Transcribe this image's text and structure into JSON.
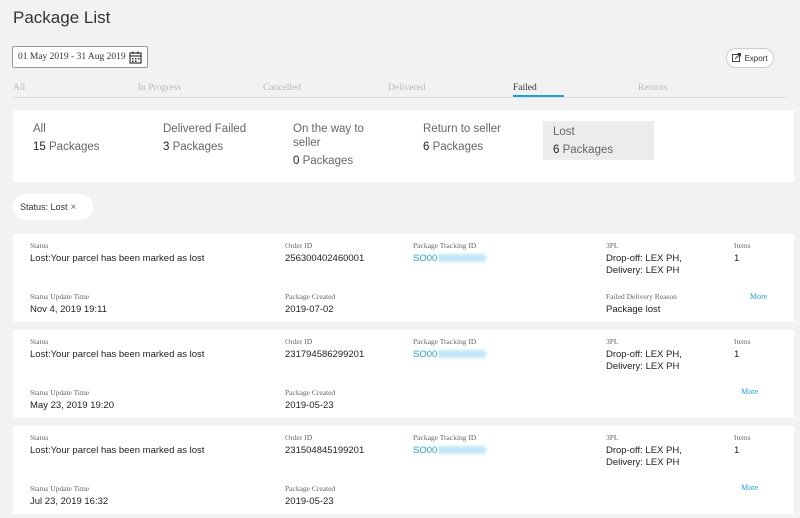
{
  "page": {
    "title": "Package List"
  },
  "date_range": {
    "value": "01 May 2019 - 31 Aug 2019"
  },
  "export": {
    "label": "Export"
  },
  "tabs": [
    {
      "label": "All"
    },
    {
      "label": "In Progress"
    },
    {
      "label": "Cancelled"
    },
    {
      "label": "Delivered"
    },
    {
      "label": "Failed"
    },
    {
      "label": "Returns"
    }
  ],
  "active_tab": "Failed",
  "summary": [
    {
      "label": "All",
      "count": "15",
      "unit": "Packages"
    },
    {
      "label": "Delivered Failed",
      "count": "3",
      "unit": "Packages"
    },
    {
      "label": "On the way to seller",
      "count": "0",
      "unit": "Packages"
    },
    {
      "label": "Return to seller",
      "count": "6",
      "unit": "Packages"
    },
    {
      "label": "Lost",
      "count": "6",
      "unit": "Packages"
    }
  ],
  "filter": {
    "label": "Status: Lost",
    "remove": "×"
  },
  "labels": {
    "status": "Status",
    "order_id": "Order ID",
    "tracking": "Package Tracking ID",
    "tpl": "3PL",
    "items": "Items",
    "status_update": "Status Update Time",
    "created": "Package Created",
    "failed_reason": "Failed Delivery Reason",
    "more": "More"
  },
  "packages": [
    {
      "status": "Lost:Your parcel has been marked as lost",
      "order_id": "256300402460001",
      "tracking_prefix": "SO00",
      "tpl_line1": "Drop-off: LEX PH,",
      "tpl_line2": "Delivery: LEX PH",
      "items": "1",
      "status_update": "Nov 4, 2019 19:11",
      "created": "2019-07-02",
      "failed_reason": "Package lost"
    },
    {
      "status": "Lost:Your parcel has been marked as lost",
      "order_id": "231794586299201",
      "tracking_prefix": "SO00",
      "tpl_line1": "Drop-off: LEX PH,",
      "tpl_line2": "Delivery: LEX PH",
      "items": "1",
      "status_update": "May 23, 2019 19:20",
      "created": "2019-05-23"
    },
    {
      "status": "Lost:Your parcel has been marked as lost",
      "order_id": "231504845199201",
      "tracking_prefix": "SO00",
      "tpl_line1": "Drop-off: LEX PH,",
      "tpl_line2": "Delivery: LEX PH",
      "items": "1",
      "status_update": "Jul 23, 2019 16:32",
      "created": "2019-05-23"
    }
  ],
  "colors": {
    "accent": "#1a9fd9",
    "background": "#f2f2f2"
  }
}
